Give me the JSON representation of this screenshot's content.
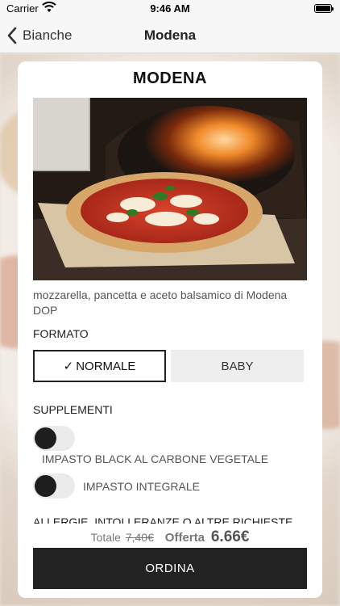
{
  "status_bar": {
    "carrier": "Carrier",
    "time": "9:46 AM"
  },
  "nav": {
    "back_label": "Bianche",
    "title": "Modena"
  },
  "product": {
    "name": "MODENA",
    "description": "mozzarella, pancetta e aceto balsamico di Modena DOP"
  },
  "format": {
    "label": "FORMATO",
    "options": [
      {
        "label": "NORMALE",
        "selected": true,
        "check": "✓"
      },
      {
        "label": "BABY",
        "selected": false
      }
    ]
  },
  "supplements": {
    "label": "SUPPLEMENTI",
    "items": [
      {
        "label": "IMPASTO BLACK AL CARBONE VEGETALE",
        "enabled": false
      },
      {
        "label": "IMPASTO INTEGRALE",
        "enabled": false
      }
    ]
  },
  "notes_label": "ALLERGIE, INTOLLERANZE O ALTRE RICHIESTE",
  "totals": {
    "total_label": "Totale",
    "old_price": "7,40€",
    "offer_label": "Offerta",
    "offer_price": "6.66€"
  },
  "order_button": "ORDINA",
  "colors": {
    "accent": "#222222",
    "background": "#eae4de",
    "toggle_track": "#ebebeb"
  }
}
